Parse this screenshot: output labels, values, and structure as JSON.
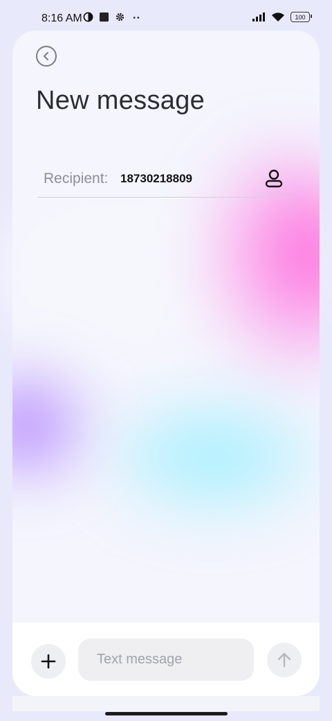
{
  "status_bar": {
    "time": "8:16 AM",
    "battery": "100",
    "left_icons": [
      "data-saver-icon",
      "square-app-icon",
      "gear-icon",
      "more-dots-icon"
    ],
    "right_icons": [
      "signal-icon",
      "wifi-icon",
      "battery-icon"
    ]
  },
  "header": {
    "back_icon": "chevron-left-circle-icon",
    "title": "New message"
  },
  "recipient": {
    "label": "Recipient:",
    "value": "18730218809",
    "contact_icon": "person-icon"
  },
  "composer": {
    "add_icon": "plus-icon",
    "placeholder": "Text message",
    "value": "",
    "send_icon": "arrow-up-icon"
  },
  "colors": {
    "accent_pink": "#ff5fd6",
    "accent_cyan": "#9ff0ff",
    "accent_purple": "#a56bff",
    "background": "#e8e9fb"
  }
}
